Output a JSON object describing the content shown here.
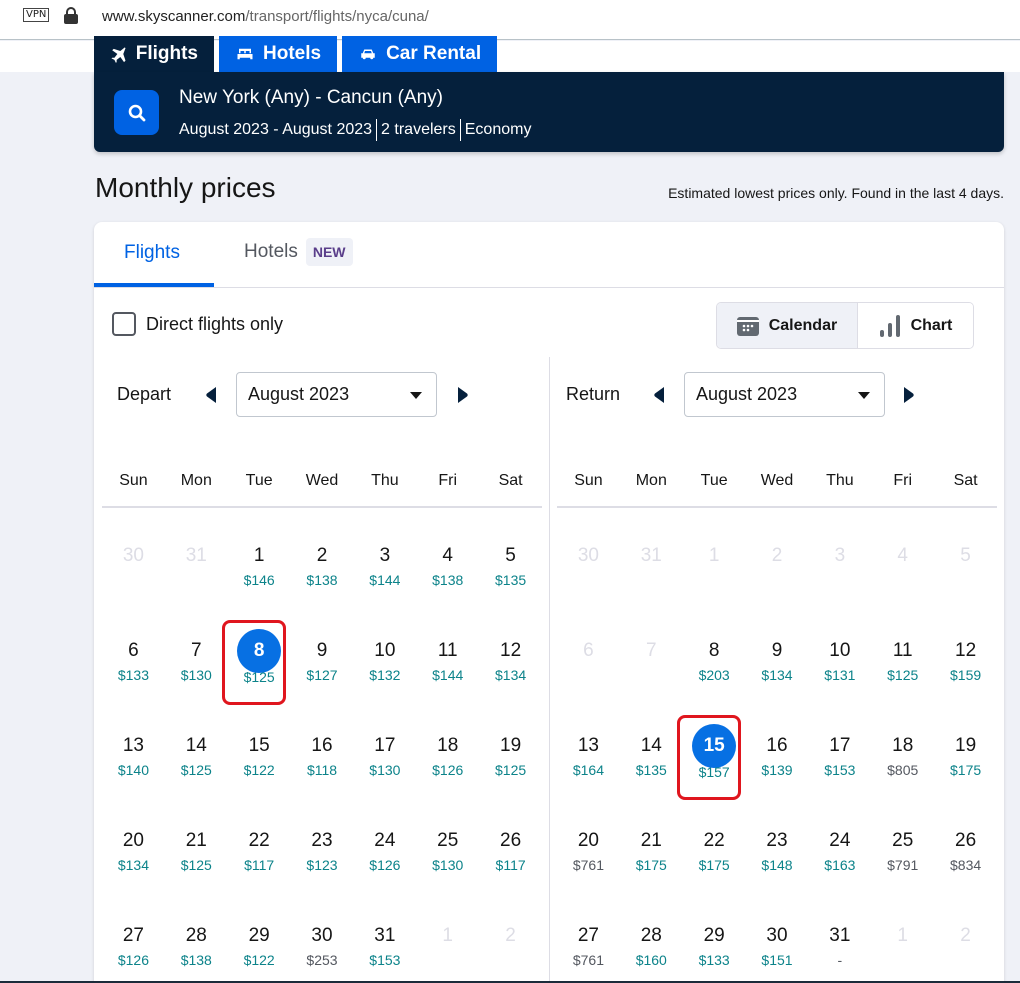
{
  "browser": {
    "vpn_label": "VPN",
    "url_host": "www.skyscanner.com",
    "url_path": "/transport/flights/nyca/cuna/"
  },
  "nav": {
    "tabs": [
      {
        "label": "Flights",
        "icon": "plane-icon",
        "active": true
      },
      {
        "label": "Hotels",
        "icon": "bed-icon",
        "active": false
      },
      {
        "label": "Car Rental",
        "icon": "car-icon",
        "active": false
      }
    ]
  },
  "search": {
    "route": "New York (Any) - Cancun (Any)",
    "dates": "August 2023 - August 2023",
    "travelers": "2 travelers",
    "cabin": "Economy"
  },
  "monthly": {
    "title": "Monthly prices",
    "note": "Estimated lowest prices only. Found in the last 4 days."
  },
  "card_tabs": {
    "flights": "Flights",
    "hotels": "Hotels",
    "hotels_badge": "NEW"
  },
  "filters": {
    "direct_label": "Direct flights only",
    "direct_checked": false
  },
  "view_toggle": {
    "calendar": "Calendar",
    "chart": "Chart",
    "selected": "Calendar"
  },
  "weekdays": [
    "Sun",
    "Mon",
    "Tue",
    "Wed",
    "Thu",
    "Fri",
    "Sat"
  ],
  "depart": {
    "label": "Depart",
    "month": "August 2023",
    "selected_day": 8,
    "days": [
      {
        "d": "30",
        "p": "",
        "muted": true
      },
      {
        "d": "31",
        "p": "",
        "muted": true
      },
      {
        "d": "1",
        "p": "$146"
      },
      {
        "d": "2",
        "p": "$138"
      },
      {
        "d": "3",
        "p": "$144"
      },
      {
        "d": "4",
        "p": "$138"
      },
      {
        "d": "5",
        "p": "$135"
      },
      {
        "d": "6",
        "p": "$133"
      },
      {
        "d": "7",
        "p": "$130"
      },
      {
        "d": "8",
        "p": "$125",
        "selected": true
      },
      {
        "d": "9",
        "p": "$127"
      },
      {
        "d": "10",
        "p": "$132"
      },
      {
        "d": "11",
        "p": "$144"
      },
      {
        "d": "12",
        "p": "$134"
      },
      {
        "d": "13",
        "p": "$140"
      },
      {
        "d": "14",
        "p": "$125"
      },
      {
        "d": "15",
        "p": "$122"
      },
      {
        "d": "16",
        "p": "$118"
      },
      {
        "d": "17",
        "p": "$130"
      },
      {
        "d": "18",
        "p": "$126"
      },
      {
        "d": "19",
        "p": "$125"
      },
      {
        "d": "20",
        "p": "$134"
      },
      {
        "d": "21",
        "p": "$125"
      },
      {
        "d": "22",
        "p": "$117"
      },
      {
        "d": "23",
        "p": "$123"
      },
      {
        "d": "24",
        "p": "$126"
      },
      {
        "d": "25",
        "p": "$130"
      },
      {
        "d": "26",
        "p": "$117"
      },
      {
        "d": "27",
        "p": "$126"
      },
      {
        "d": "28",
        "p": "$138"
      },
      {
        "d": "29",
        "p": "$122"
      },
      {
        "d": "30",
        "p": "$253",
        "gray": true
      },
      {
        "d": "31",
        "p": "$153"
      },
      {
        "d": "1",
        "p": "",
        "muted": true
      },
      {
        "d": "2",
        "p": "",
        "muted": true
      }
    ]
  },
  "return": {
    "label": "Return",
    "month": "August 2023",
    "selected_day": 15,
    "days": [
      {
        "d": "30",
        "p": "",
        "muted": true
      },
      {
        "d": "31",
        "p": "",
        "muted": true
      },
      {
        "d": "1",
        "p": "",
        "muted": true
      },
      {
        "d": "2",
        "p": "",
        "muted": true
      },
      {
        "d": "3",
        "p": "",
        "muted": true
      },
      {
        "d": "4",
        "p": "",
        "muted": true
      },
      {
        "d": "5",
        "p": "",
        "muted": true
      },
      {
        "d": "6",
        "p": "",
        "muted": true
      },
      {
        "d": "7",
        "p": "",
        "muted": true
      },
      {
        "d": "8",
        "p": "$203"
      },
      {
        "d": "9",
        "p": "$134"
      },
      {
        "d": "10",
        "p": "$131"
      },
      {
        "d": "11",
        "p": "$125"
      },
      {
        "d": "12",
        "p": "$159"
      },
      {
        "d": "13",
        "p": "$164"
      },
      {
        "d": "14",
        "p": "$135"
      },
      {
        "d": "15",
        "p": "$157",
        "selected": true
      },
      {
        "d": "16",
        "p": "$139"
      },
      {
        "d": "17",
        "p": "$153"
      },
      {
        "d": "18",
        "p": "$805",
        "gray": true
      },
      {
        "d": "19",
        "p": "$175"
      },
      {
        "d": "20",
        "p": "$761",
        "gray": true
      },
      {
        "d": "21",
        "p": "$175"
      },
      {
        "d": "22",
        "p": "$175"
      },
      {
        "d": "23",
        "p": "$148"
      },
      {
        "d": "24",
        "p": "$163"
      },
      {
        "d": "25",
        "p": "$791",
        "gray": true
      },
      {
        "d": "26",
        "p": "$834",
        "gray": true
      },
      {
        "d": "27",
        "p": "$761",
        "gray": true
      },
      {
        "d": "28",
        "p": "$160"
      },
      {
        "d": "29",
        "p": "$133"
      },
      {
        "d": "30",
        "p": "$151"
      },
      {
        "d": "31",
        "p": "-",
        "gray": true
      },
      {
        "d": "1",
        "p": "",
        "muted": true
      },
      {
        "d": "2",
        "p": "",
        "muted": true
      }
    ]
  },
  "colors": {
    "brand_blue": "#0062e3",
    "navy": "#05203c",
    "price_green": "#0c838a",
    "price_gray": "#545860",
    "highlight_red": "#e0161e"
  }
}
